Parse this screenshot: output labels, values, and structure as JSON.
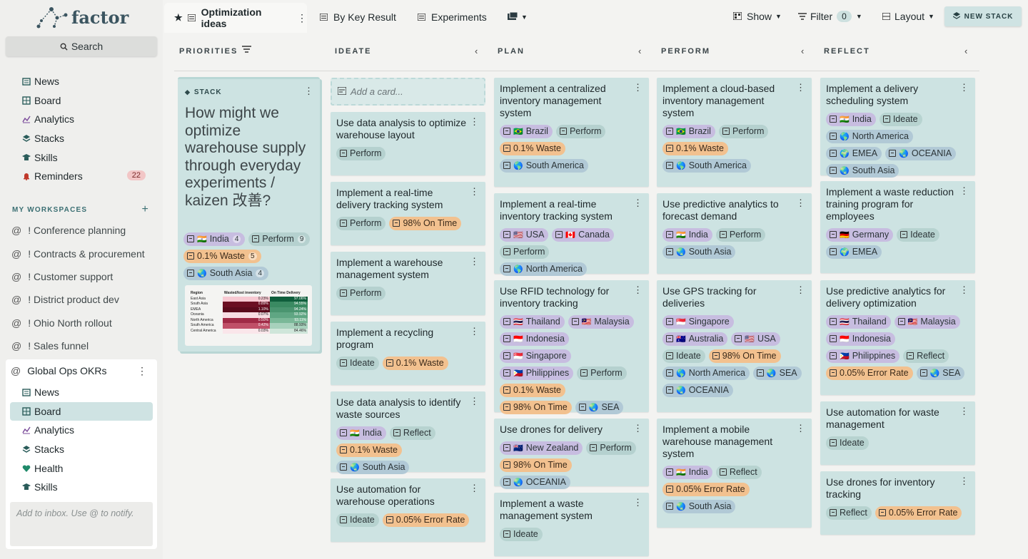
{
  "app": {
    "brand": "factor"
  },
  "sidebar": {
    "search_label": "Search",
    "items": [
      {
        "label": "News",
        "icon": "news-icon"
      },
      {
        "label": "Board",
        "icon": "board-icon"
      },
      {
        "label": "Analytics",
        "icon": "analytics-icon"
      },
      {
        "label": "Stacks",
        "icon": "stacks-icon"
      },
      {
        "label": "Skills",
        "icon": "skills-icon"
      },
      {
        "label": "Reminders",
        "icon": "bell-icon",
        "badge": "22"
      }
    ],
    "workspaces_heading": "MY WORKSPACES",
    "workspaces": [
      "! Conference planning",
      "! Contracts & procurement",
      "! Customer support",
      "! District product dev",
      "! Ohio North rollout",
      "! Sales funnel"
    ],
    "global_ops": {
      "title": "Global Ops OKRs",
      "items": [
        {
          "label": "News"
        },
        {
          "label": "Board"
        },
        {
          "label": "Analytics"
        },
        {
          "label": "Stacks"
        },
        {
          "label": "Health"
        },
        {
          "label": "Skills"
        }
      ],
      "inbox_placeholder": "Add to inbox. Use @ to notify."
    }
  },
  "topbar": {
    "active_tab": "Optimization ideas",
    "tabs": [
      "By Key Result",
      "Experiments"
    ],
    "show_label": "Show",
    "filter_label": "Filter",
    "filter_count": "0",
    "layout_label": "Layout",
    "new_stack_label": "NEW STACK"
  },
  "columns": {
    "priorities": "PRIORITIES",
    "ideate": "IDEATE",
    "plan": "PLAN",
    "perform": "PERFORM",
    "reflect": "REFLECT"
  },
  "stack": {
    "label": "STACK",
    "title": "How might we optimize warehouse supply through everyday experiments / kaizen 改善?",
    "tags": [
      {
        "text": "India",
        "flag": "🇮🇳",
        "count": "4",
        "kind": "country"
      },
      {
        "text": "Perform",
        "count": "9",
        "kind": "perform"
      },
      {
        "text": "0.1% Waste",
        "count": "5",
        "kind": "metric"
      },
      {
        "text": "South Asia",
        "flag": "🌏",
        "count": "4",
        "kind": "region"
      }
    ],
    "thumbnail": {
      "headers": [
        "Region",
        "Wasted/lost inventory",
        "On Time Delivery"
      ],
      "rows": [
        [
          "East Asia",
          "0.23%",
          "97.06%"
        ],
        [
          "South Asia",
          "0.89%",
          "94.55%"
        ],
        [
          "EMEA",
          "1.10%",
          "94.24%"
        ],
        [
          "Oceania",
          "0.07%",
          "93.92%"
        ],
        [
          "North America",
          "0.50%",
          "93.11%"
        ],
        [
          "South America",
          "0.42%",
          "88.93%"
        ],
        [
          "Central America",
          "0.03%",
          "84.46%"
        ]
      ]
    }
  },
  "add_card_placeholder": "Add a card...",
  "cards": {
    "ideate": [
      {
        "title": "Use data analysis to optimize warehouse layout",
        "tags": [
          {
            "text": "Perform",
            "kind": "perform"
          }
        ]
      },
      {
        "title": "Implement a real-time delivery tracking system",
        "tags": [
          {
            "text": "Perform",
            "kind": "perform"
          },
          {
            "text": "98% On Time",
            "kind": "metric"
          }
        ]
      },
      {
        "title": "Implement a warehouse management system",
        "tags": [
          {
            "text": "Perform",
            "kind": "perform"
          }
        ]
      },
      {
        "title": "Implement a recycling program",
        "tags": [
          {
            "text": "Ideate",
            "kind": "stage2"
          },
          {
            "text": "0.1% Waste",
            "kind": "metric"
          }
        ]
      },
      {
        "title": "Use data analysis to identify waste sources",
        "tags": [
          {
            "text": "India",
            "flag": "🇮🇳",
            "kind": "country"
          },
          {
            "text": "Reflect",
            "kind": "stage2"
          },
          {
            "text": "0.1% Waste",
            "kind": "metric"
          },
          {
            "text": "South Asia",
            "flag": "🌏",
            "kind": "region"
          }
        ]
      },
      {
        "title": "Use automation for warehouse operations",
        "tags": [
          {
            "text": "Ideate",
            "kind": "stage2"
          },
          {
            "text": "0.05% Error Rate",
            "kind": "metric"
          }
        ]
      }
    ],
    "plan": [
      {
        "title": "Implement a centralized inventory management system",
        "tags": [
          {
            "text": "Brazil",
            "flag": "🇧🇷",
            "kind": "country"
          },
          {
            "text": "Perform",
            "kind": "perform"
          },
          {
            "text": "0.1% Waste",
            "kind": "metric"
          },
          {
            "text": "South America",
            "flag": "🌎",
            "kind": "region"
          }
        ]
      },
      {
        "title": "Implement a real-time inventory tracking system",
        "tags": [
          {
            "text": "USA",
            "flag": "🇺🇸",
            "kind": "country"
          },
          {
            "text": "Canada",
            "flag": "🇨🇦",
            "kind": "country"
          },
          {
            "text": "Perform",
            "kind": "perform"
          },
          {
            "text": "North America",
            "flag": "🌎",
            "kind": "region"
          }
        ]
      },
      {
        "title": "Use RFID technology for inventory tracking",
        "tags": [
          {
            "text": "Thailand",
            "flag": "🇹🇭",
            "kind": "country"
          },
          {
            "text": "Malaysia",
            "flag": "🇲🇾",
            "kind": "country"
          },
          {
            "text": "Indonesia",
            "flag": "🇮🇩",
            "kind": "country"
          },
          {
            "text": "Singapore",
            "flag": "🇸🇬",
            "kind": "country"
          },
          {
            "text": "Philippines",
            "flag": "🇵🇭",
            "kind": "country"
          },
          {
            "text": "Perform",
            "kind": "perform"
          },
          {
            "text": "0.1% Waste",
            "kind": "metric"
          },
          {
            "text": "98% On Time",
            "kind": "metric"
          },
          {
            "text": "SEA",
            "flag": "🌏",
            "kind": "region"
          }
        ]
      },
      {
        "title": "Use drones for delivery",
        "tags": [
          {
            "text": "New Zealand",
            "flag": "🇳🇿",
            "kind": "country"
          },
          {
            "text": "Perform",
            "kind": "perform"
          },
          {
            "text": "98% On Time",
            "kind": "metric"
          },
          {
            "text": "OCEANIA",
            "flag": "🌏",
            "kind": "region"
          }
        ]
      },
      {
        "title": "Implement a waste management system",
        "tags": [
          {
            "text": "Ideate",
            "kind": "stage2"
          }
        ]
      }
    ],
    "perform": [
      {
        "title": "Implement a cloud-based inventory management system",
        "tags": [
          {
            "text": "Brazil",
            "flag": "🇧🇷",
            "kind": "country"
          },
          {
            "text": "Perform",
            "kind": "perform"
          },
          {
            "text": "0.1% Waste",
            "kind": "metric"
          },
          {
            "text": "South America",
            "flag": "🌎",
            "kind": "region"
          }
        ]
      },
      {
        "title": "Use predictive analytics to forecast demand",
        "tags": [
          {
            "text": "India",
            "flag": "🇮🇳",
            "kind": "country"
          },
          {
            "text": "Perform",
            "kind": "perform"
          },
          {
            "text": "South Asia",
            "flag": "🌏",
            "kind": "region"
          }
        ]
      },
      {
        "title": "Use GPS tracking for deliveries",
        "tags": [
          {
            "text": "Singapore",
            "flag": "🇸🇬",
            "kind": "country"
          },
          {
            "text": "Australia",
            "flag": "🇦🇺",
            "kind": "country"
          },
          {
            "text": "USA",
            "flag": "🇺🇸",
            "kind": "country"
          },
          {
            "text": "Ideate",
            "kind": "stage2"
          },
          {
            "text": "98% On Time",
            "kind": "metric"
          },
          {
            "text": "North America",
            "flag": "🌎",
            "kind": "region"
          },
          {
            "text": "SEA",
            "flag": "🌏",
            "kind": "region"
          },
          {
            "text": "OCEANIA",
            "flag": "🌏",
            "kind": "region"
          }
        ]
      },
      {
        "title": "Implement a mobile warehouse management system",
        "tags": [
          {
            "text": "India",
            "flag": "🇮🇳",
            "kind": "country"
          },
          {
            "text": "Reflect",
            "kind": "stage2"
          },
          {
            "text": "0.05% Error Rate",
            "kind": "metric"
          },
          {
            "text": "South Asia",
            "flag": "🌏",
            "kind": "region"
          }
        ]
      }
    ],
    "reflect": [
      {
        "title": "Implement a delivery scheduling system",
        "tags": [
          {
            "text": "India",
            "flag": "🇮🇳",
            "kind": "country"
          },
          {
            "text": "Ideate",
            "kind": "stage2"
          },
          {
            "text": "North America",
            "flag": "🌎",
            "kind": "region"
          },
          {
            "text": "EMEA",
            "flag": "🌍",
            "kind": "region"
          },
          {
            "text": "OCEANIA",
            "flag": "🌏",
            "kind": "region"
          },
          {
            "text": "South Asia",
            "flag": "🌏",
            "kind": "region"
          }
        ]
      },
      {
        "title": "Implement a waste reduction training program for employees",
        "tags": [
          {
            "text": "Germany",
            "flag": "🇩🇪",
            "kind": "country"
          },
          {
            "text": "Ideate",
            "kind": "stage2"
          },
          {
            "text": "EMEA",
            "flag": "🌍",
            "kind": "region"
          }
        ]
      },
      {
        "title": "Use predictive analytics for delivery optimization",
        "tags": [
          {
            "text": "Thailand",
            "flag": "🇹🇭",
            "kind": "country"
          },
          {
            "text": "Malaysia",
            "flag": "🇲🇾",
            "kind": "country"
          },
          {
            "text": "Indonesia",
            "flag": "🇮🇩",
            "kind": "country"
          },
          {
            "text": "Philippines",
            "flag": "🇵🇭",
            "kind": "country"
          },
          {
            "text": "Reflect",
            "kind": "stage2"
          },
          {
            "text": "0.05% Error Rate",
            "kind": "metric"
          },
          {
            "text": "SEA",
            "flag": "🌏",
            "kind": "region"
          }
        ]
      },
      {
        "title": "Use automation for waste management",
        "tags": [
          {
            "text": "Ideate",
            "kind": "stage2"
          }
        ]
      },
      {
        "title": "Use drones for inventory tracking",
        "tags": [
          {
            "text": "Reflect",
            "kind": "stage2"
          },
          {
            "text": "0.05% Error Rate",
            "kind": "metric"
          }
        ]
      }
    ]
  }
}
